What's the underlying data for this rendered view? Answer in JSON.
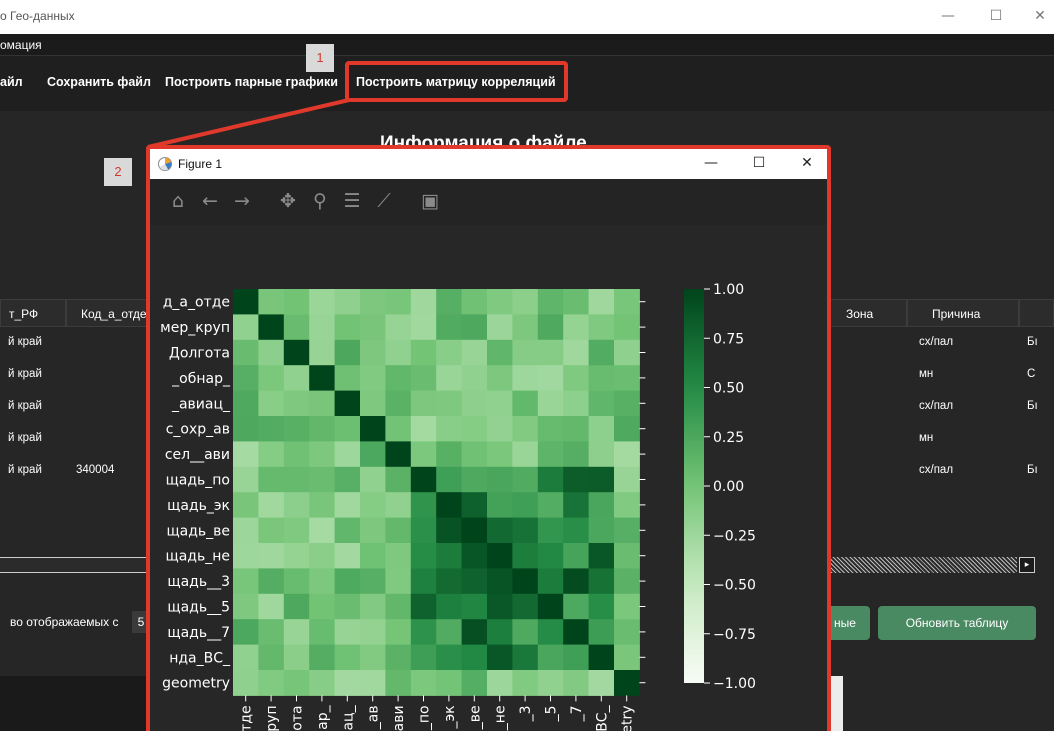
{
  "window": {
    "title": "о Гео-данных",
    "minimize": "—",
    "maximize": "☐",
    "close": "✕"
  },
  "menu": {
    "item": "омация"
  },
  "toolbar": {
    "open_label": "айл",
    "save_label": "Сохранить файл",
    "pairplot_label": "Построить парные графики",
    "corr_label": "Построить матрицу корреляций"
  },
  "heading": "Информация о файле",
  "table": {
    "headers": [
      "т_РФ",
      "Код_а_отде",
      "Зона",
      "Причина"
    ],
    "rows": [
      [
        "й край",
        "",
        "сх/пал",
        "Бı"
      ],
      [
        "й край",
        "",
        "мн",
        "С"
      ],
      [
        "й край",
        "",
        "сх/пал",
        "Бı"
      ],
      [
        "й край",
        "",
        "мн",
        ""
      ],
      [
        "й край",
        "340004",
        "сх/пал",
        "Бı"
      ]
    ]
  },
  "rows_label": "во отображаемых с",
  "rows_value": "5",
  "buttons": {
    "data_label": "ные",
    "refresh_label": "Обновить таблицу"
  },
  "annotations": {
    "n1": "1",
    "n2": "2"
  },
  "colors": {
    "accent": "#e0392c",
    "button_green": "#4a8a63"
  },
  "figure": {
    "title": "Figure 1",
    "icon": "matplotlib-icon",
    "minimize": "—",
    "maximize": "☐",
    "close": "✕",
    "tools": [
      {
        "name": "home-icon",
        "glyph": "⌂"
      },
      {
        "name": "back-icon",
        "glyph": "←"
      },
      {
        "name": "forward-icon",
        "glyph": "→"
      },
      {
        "name": "pan-icon",
        "glyph": "✥"
      },
      {
        "name": "zoom-icon",
        "glyph": "⚲"
      },
      {
        "name": "subplots-icon",
        "glyph": "☰"
      },
      {
        "name": "axes-icon",
        "glyph": "⟋"
      },
      {
        "name": "save-icon",
        "glyph": "▣"
      }
    ]
  },
  "chart_data": {
    "type": "heatmap",
    "colormap": "Greens",
    "vmin": -1.0,
    "vmax": 1.0,
    "row_labels": [
      "д_а_отде",
      "мер_круп",
      "Долгота",
      "_обнар_",
      "_авиац_",
      "с_охр_ав",
      "сел__ави",
      "щадь_по",
      "щадь_эк",
      "щадь_ве",
      "щадь_не",
      "щадь__3",
      "щадь__5",
      "щадь__7",
      "нда_ВС_",
      "geometry"
    ],
    "col_labels": [
      "отде",
      "круп",
      "гота",
      "ар_",
      "иац_",
      "_ав",
      "ави",
      "_по",
      "_эк",
      "_ве",
      "_не",
      "_3",
      "_5",
      "_7",
      "ВС_",
      "etry"
    ],
    "colorbar_ticks": [
      1.0,
      0.75,
      0.5,
      0.25,
      0.0,
      -0.25,
      -0.5,
      -0.75,
      -1.0
    ],
    "colorbar_tick_labels": [
      "1.00",
      "0.75",
      "0.50",
      "0.25",
      "0.00",
      "−0.25",
      "−0.50",
      "−0.75",
      "−1.00"
    ]
  }
}
